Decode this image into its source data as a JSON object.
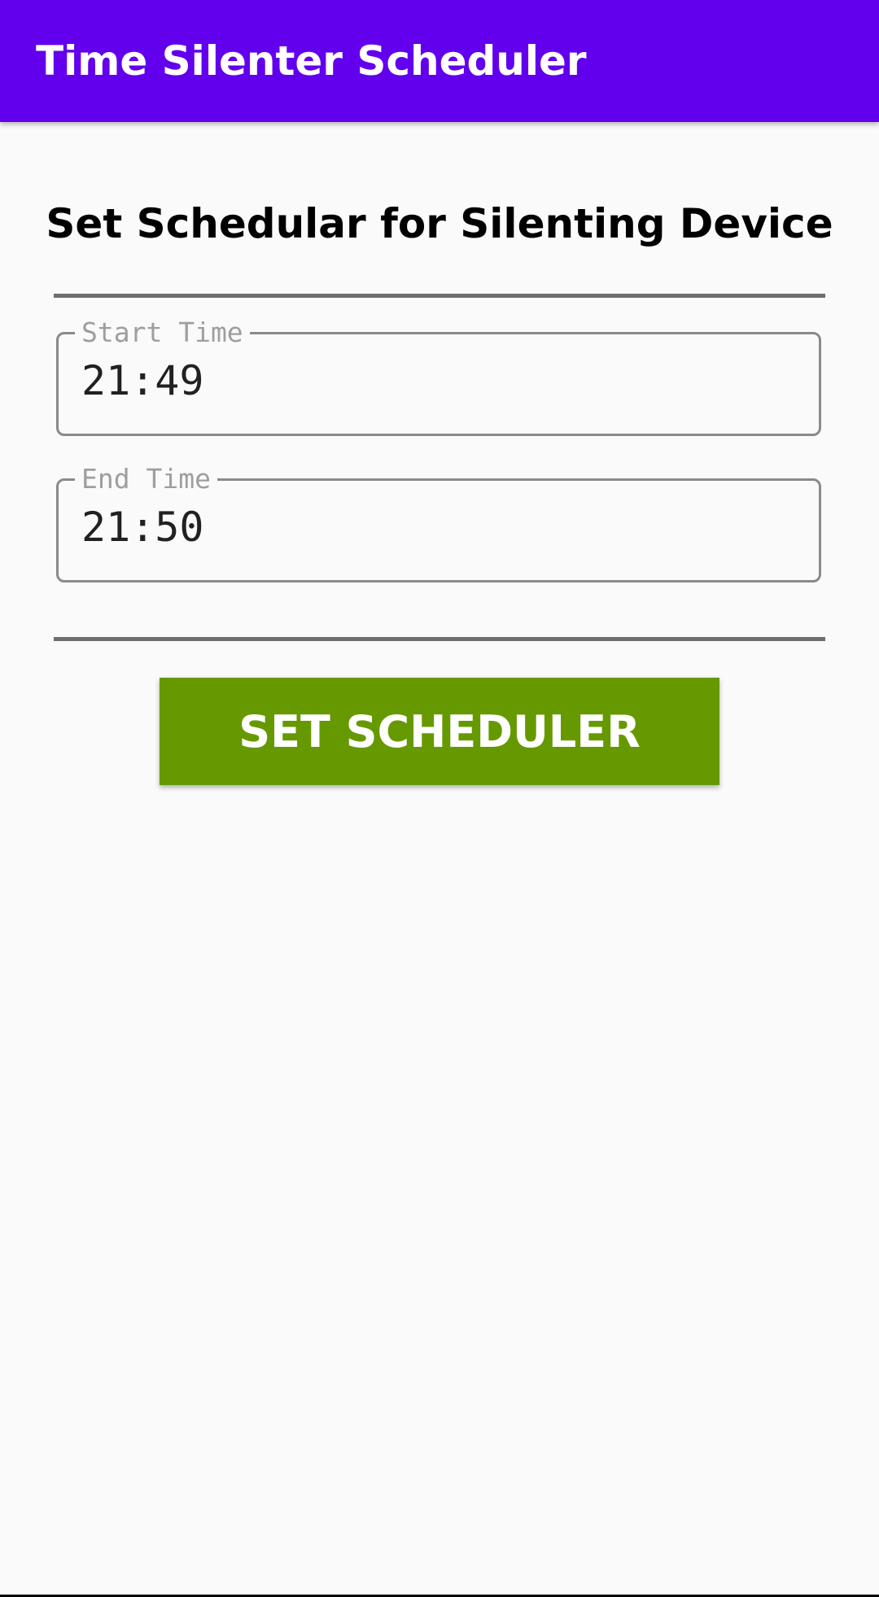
{
  "app_bar": {
    "title": "Time Silenter Scheduler",
    "color": "#6200EE"
  },
  "main": {
    "heading": "Set Schedular for Silenting Device",
    "start_time": {
      "label": "Start Time",
      "value": "21:49"
    },
    "end_time": {
      "label": "End Time",
      "value": "21:50"
    },
    "set_button": {
      "label": "SET SCHEDULER",
      "color": "#669900"
    }
  }
}
